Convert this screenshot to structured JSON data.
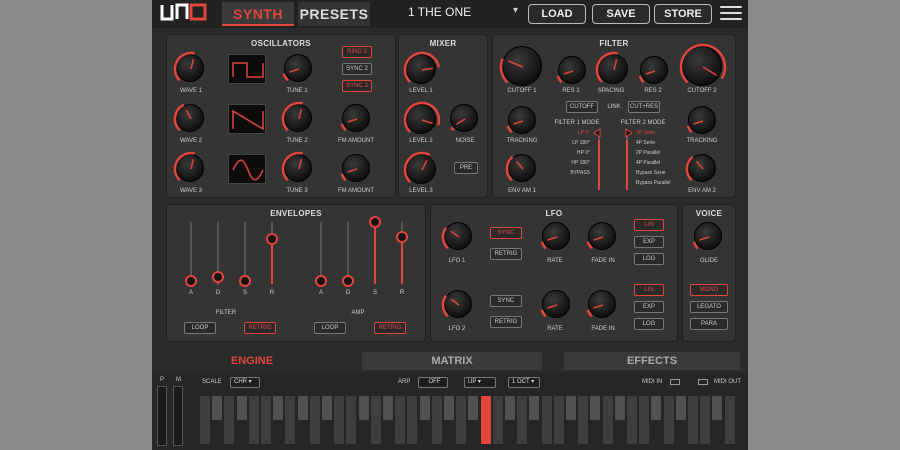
{
  "topbar": {
    "tab_synth": "SYNTH",
    "tab_presets": "PRESETS",
    "preset_name": "1 THE ONE",
    "load": "LOAD",
    "save": "SAVE",
    "store": "STORE"
  },
  "oscillators": {
    "title": "OSCILLATORS",
    "wave1": "WAVE 1",
    "wave2": "WAVE 2",
    "wave3": "WAVE 3",
    "tune1": "TUNE 1",
    "tune2": "TUNE 2",
    "tune3": "TUNE 3",
    "fm1": "FM AMOUNT",
    "fm2": "FM AMOUNT",
    "ring2": "RING 2",
    "sync2": "SYNC 2",
    "sync3": "SYNC 3"
  },
  "mixer": {
    "title": "MIXER",
    "level1": "LEVEL 1",
    "level2": "LEVEL 2",
    "level3": "LEVEL 3",
    "noise": "NOISE",
    "pre": "PRE"
  },
  "filter": {
    "title": "FILTER",
    "cutoff1": "CUTOFF 1",
    "res1": "RES 1",
    "spacing": "SPACING",
    "res2": "RES 2",
    "cutoff2": "CUTOFF 2",
    "cutoff_btn": "CUTOFF",
    "link": "LINK",
    "cutres_btn": "CUT+RES",
    "tracking1": "TRACKING",
    "tracking2": "TRACKING",
    "envam1": "ENV AM 1",
    "envam2": "ENV AM 2",
    "mode1_title": "FILTER 1 MODE",
    "mode2_title": "FILTER 2 MODE",
    "mode1": [
      "LP 0°",
      "LP 180°",
      "HP 0°",
      "HP 180°",
      "BYPASS"
    ],
    "mode2": [
      "2P Serie",
      "4P Serie",
      "2P Parallel",
      "4P Parallel",
      "Bypass Serie",
      "Bypass Parallel"
    ]
  },
  "envelopes": {
    "title": "ENVELOPES",
    "filter_label": "FILTER",
    "amp_label": "AMP",
    "adsr": [
      "A",
      "D",
      "S",
      "R"
    ],
    "filter_values": [
      0.05,
      0.12,
      0.05,
      0.72
    ],
    "amp_values": [
      0.05,
      0.05,
      1.0,
      0.75
    ],
    "loop": "LOOP",
    "retrig": "RETRIG"
  },
  "lfo": {
    "title": "LFO",
    "lfo1": "LFO 1",
    "lfo2": "LFO 2",
    "sync": "SYNC",
    "retrig": "RETRIG",
    "rate": "RATE",
    "fadein": "FADE IN",
    "lin": "LIN",
    "exp": "EXP",
    "log": "LOG"
  },
  "voice": {
    "title": "VOICE",
    "glide": "GLIDE",
    "mono": "MONO",
    "legato": "LEGATO",
    "para": "PARA"
  },
  "bottom_tabs": {
    "engine": "ENGINE",
    "matrix": "MATRIX",
    "effects": "EFFECTS"
  },
  "keyboard": {
    "p": "P",
    "m": "M",
    "scale_label": "SCALE",
    "scale_value": "CHR",
    "arp_label": "ARP",
    "arp_value": "OFF",
    "arp_dir": "UP",
    "arp_oct": "1 OCT",
    "midi_in": "MIDI IN",
    "midi_out": "MIDI OUT"
  },
  "colors": {
    "accent": "#e0463c",
    "panel": "#343434",
    "bg": "#2a2a2a"
  }
}
